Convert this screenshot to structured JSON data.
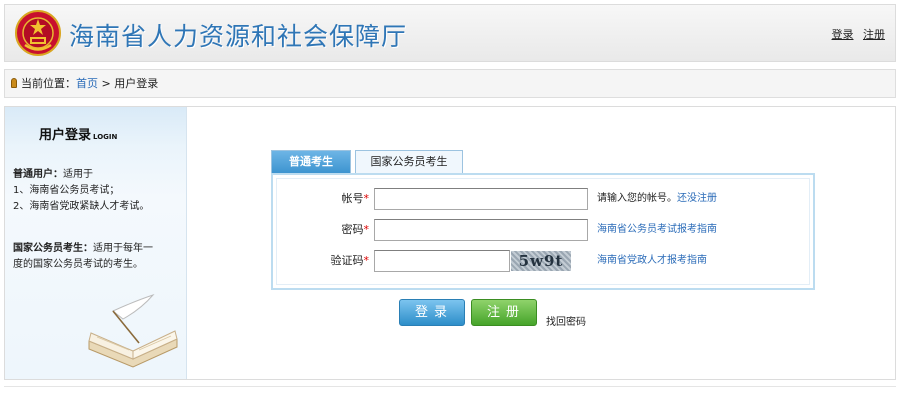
{
  "header": {
    "title": "海南省人力资源和社会保障厅",
    "emblem_icon": "national-emblem-icon",
    "links": {
      "login": "登录",
      "register": "注册"
    }
  },
  "breadcrumb": {
    "prefix": "当前位置：",
    "home": "首页",
    "separator": " > ",
    "current": "用户登录"
  },
  "sidebar": {
    "title": "用户登录",
    "title_en": "LOGIN",
    "normal_user_heading": "普通用户：",
    "normal_user_desc": "适用于",
    "normal_user_items": [
      "1、海南省公务员考试；",
      "2、海南省党政紧缺人才考试。"
    ],
    "civil_heading": "国家公务员考生：",
    "civil_desc_1": "适用于每年一",
    "civil_desc_2": "度的国家公务员考试的考生。",
    "illustration_icon": "book-quill-icon"
  },
  "tabs": [
    {
      "label": "普通考生",
      "active": true
    },
    {
      "label": "国家公务员考生",
      "active": false
    }
  ],
  "form": {
    "account": {
      "label": "帐号",
      "required": "*",
      "value": "",
      "hint": "请输入您的帐号。",
      "link": "还没注册"
    },
    "password": {
      "label": "密码",
      "required": "*",
      "value": "",
      "link": "海南省公务员考试报考指南"
    },
    "captcha": {
      "label": "验证码",
      "required": "*",
      "value": "",
      "image_text": "5w9t",
      "link": "海南省党政人才报考指南"
    }
  },
  "buttons": {
    "login": "登录",
    "register": "注册",
    "find_password": "找回密码"
  },
  "colors": {
    "title_blue": "#2f76b6",
    "link_blue": "#2a6bb8",
    "login_btn": "#2d8ec9",
    "register_btn": "#46a42a",
    "required_red": "#d00000"
  }
}
